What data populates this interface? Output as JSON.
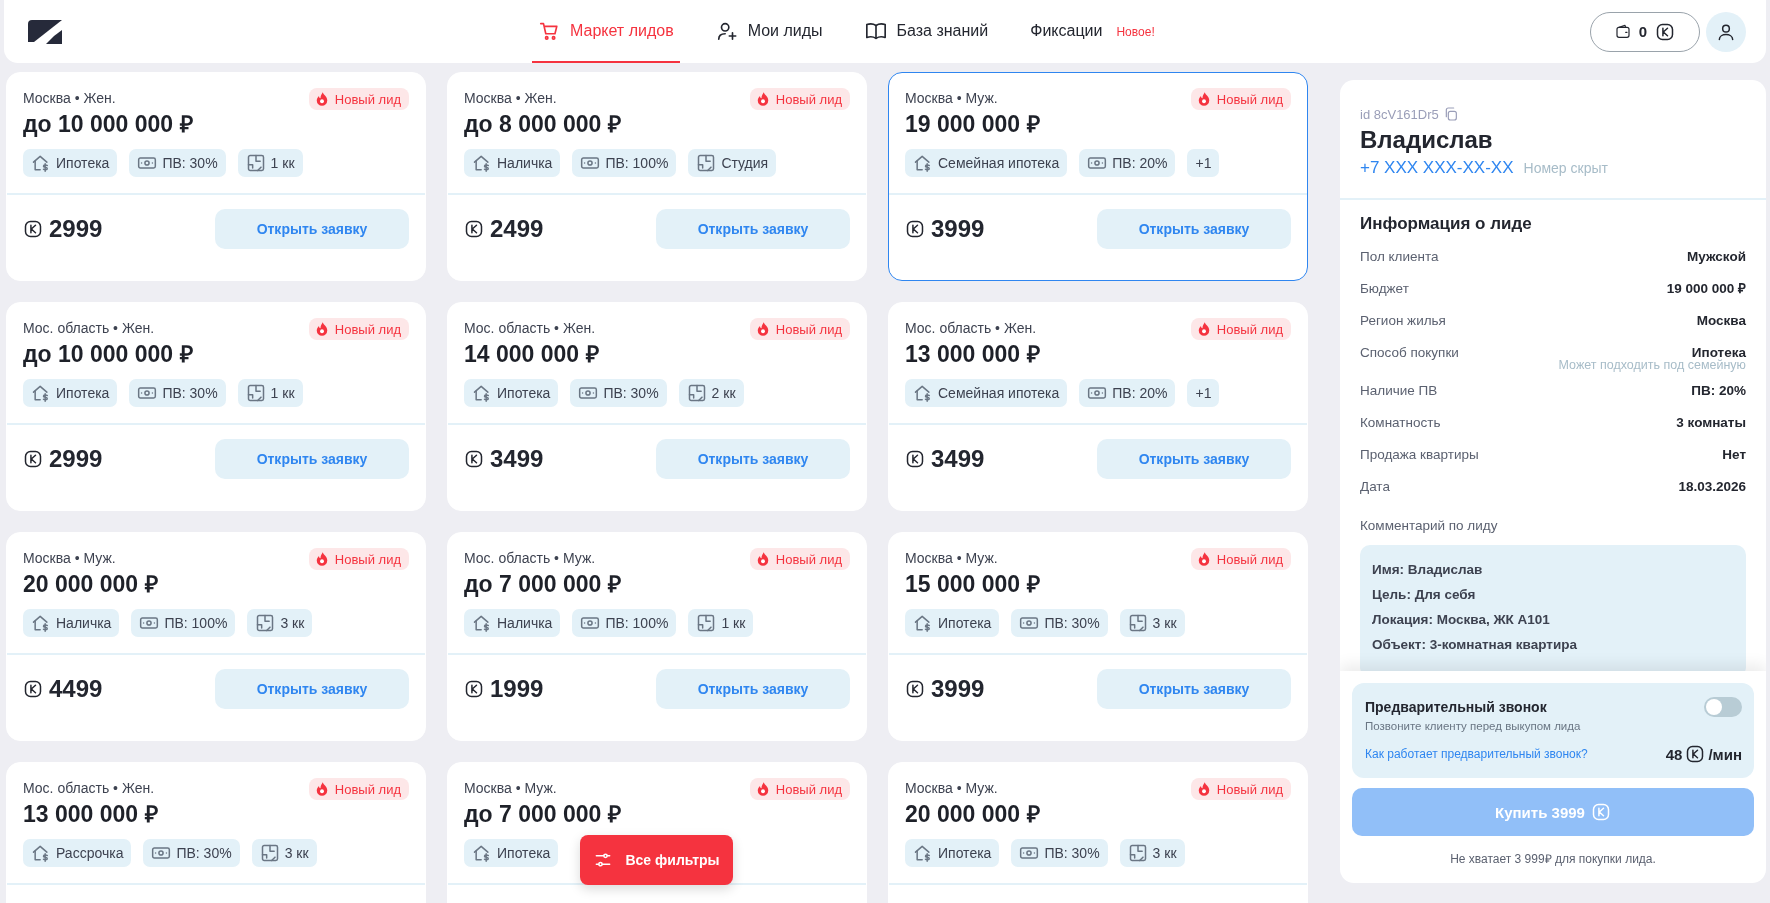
{
  "header": {
    "tabs": [
      {
        "kind": "cart",
        "label": "Маркет лидов",
        "selected": true
      },
      {
        "kind": "user-plus",
        "label": "Мои лиды",
        "selected": false
      },
      {
        "kind": "book",
        "label": "База знаний",
        "selected": false
      },
      {
        "kind": "none",
        "label": "Фиксации",
        "selected": false,
        "badge": "Новое!"
      }
    ],
    "balance": "0"
  },
  "cards": [
    {
      "location": "Москва • Жен.",
      "badge": "Новый лид",
      "budget": "до 10 000 000 ₽",
      "tags": [
        {
          "kind": "purchase",
          "label": "Ипотека"
        },
        {
          "kind": "pv",
          "label": "ПВ: 30%"
        },
        {
          "kind": "rooms",
          "label": "1 кк"
        }
      ],
      "price": "2999",
      "button": "Открыть заявку",
      "selected": false
    },
    {
      "location": "Москва • Жен.",
      "badge": "Новый лид",
      "budget": "до 8 000 000 ₽",
      "tags": [
        {
          "kind": "purchase",
          "label": "Наличка"
        },
        {
          "kind": "pv",
          "label": "ПВ: 100%"
        },
        {
          "kind": "rooms",
          "label": "Студия"
        }
      ],
      "price": "2499",
      "button": "Открыть заявку",
      "selected": false
    },
    {
      "location": "Москва • Муж.",
      "badge": "Новый лид",
      "budget": "19 000 000 ₽",
      "tags": [
        {
          "kind": "purchase",
          "label": "Семейная ипотека"
        },
        {
          "kind": "pv",
          "label": "ПВ: 20%"
        },
        {
          "kind": "more",
          "label": "+1"
        }
      ],
      "price": "3999",
      "button": "Открыть заявку",
      "selected": true
    },
    {
      "location": "Мос. область • Жен.",
      "badge": "Новый лид",
      "budget": "до 10 000 000 ₽",
      "tags": [
        {
          "kind": "purchase",
          "label": "Ипотека"
        },
        {
          "kind": "pv",
          "label": "ПВ: 30%"
        },
        {
          "kind": "rooms",
          "label": "1 кк"
        }
      ],
      "price": "2999",
      "button": "Открыть заявку",
      "selected": false
    },
    {
      "location": "Мос. область • Жен.",
      "badge": "Новый лид",
      "budget": "14 000 000 ₽",
      "tags": [
        {
          "kind": "purchase",
          "label": "Ипотека"
        },
        {
          "kind": "pv",
          "label": "ПВ: 30%"
        },
        {
          "kind": "rooms",
          "label": "2 кк"
        }
      ],
      "price": "3499",
      "button": "Открыть заявку",
      "selected": false
    },
    {
      "location": "Мос. область • Жен.",
      "badge": "Новый лид",
      "budget": "13 000 000 ₽",
      "tags": [
        {
          "kind": "purchase",
          "label": "Семейная ипотека"
        },
        {
          "kind": "pv",
          "label": "ПВ: 20%"
        },
        {
          "kind": "more",
          "label": "+1"
        }
      ],
      "price": "3499",
      "button": "Открыть заявку",
      "selected": false
    },
    {
      "location": "Москва • Муж.",
      "badge": "Новый лид",
      "budget": "20 000 000 ₽",
      "tags": [
        {
          "kind": "purchase",
          "label": "Наличка"
        },
        {
          "kind": "pv",
          "label": "ПВ: 100%"
        },
        {
          "kind": "rooms",
          "label": "3 кк"
        }
      ],
      "price": "4499",
      "button": "Открыть заявку",
      "selected": false
    },
    {
      "location": "Мос. область • Муж.",
      "badge": "Новый лид",
      "budget": "до 7 000 000 ₽",
      "tags": [
        {
          "kind": "purchase",
          "label": "Наличка"
        },
        {
          "kind": "pv",
          "label": "ПВ: 100%"
        },
        {
          "kind": "rooms",
          "label": "1 кк"
        }
      ],
      "price": "1999",
      "button": "Открыть заявку",
      "selected": false
    },
    {
      "location": "Москва • Муж.",
      "badge": "Новый лид",
      "budget": "15 000 000 ₽",
      "tags": [
        {
          "kind": "purchase",
          "label": "Ипотека"
        },
        {
          "kind": "pv",
          "label": "ПВ: 30%"
        },
        {
          "kind": "rooms",
          "label": "3 кк"
        }
      ],
      "price": "3999",
      "button": "Открыть заявку",
      "selected": false
    },
    {
      "location": "Мос. область • Жен.",
      "badge": "Новый лид",
      "budget": "13 000 000 ₽",
      "tags": [
        {
          "kind": "purchase",
          "label": "Рассрочка"
        },
        {
          "kind": "pv",
          "label": "ПВ: 30%"
        },
        {
          "kind": "rooms",
          "label": "3 кк"
        }
      ],
      "selected": false
    },
    {
      "location": "Москва • Муж.",
      "badge": "Новый лид",
      "budget": "до 7 000 000 ₽",
      "tags": [
        {
          "kind": "purchase",
          "label": "Ипотека"
        }
      ],
      "selected": false
    },
    {
      "location": "Москва • Муж.",
      "badge": "Новый лид",
      "budget": "20 000 000 ₽",
      "tags": [
        {
          "kind": "purchase",
          "label": "Ипотека"
        },
        {
          "kind": "pv",
          "label": "ПВ: 30%"
        },
        {
          "kind": "rooms",
          "label": "3 кк"
        }
      ],
      "selected": false
    }
  ],
  "filter_button": "Все фильтры",
  "lead": {
    "id": "id 8cV161Dr5",
    "name": "Владислав",
    "phone": "+7 XXX XXX-XX-XX",
    "phone_note": "Номер скрыт",
    "info_title": "Информация о лиде",
    "info": [
      {
        "label": "Пол клиента",
        "value": "Мужской"
      },
      {
        "label": "Бюджет",
        "value": "19 000 000 ₽"
      },
      {
        "label": "Регион жилья",
        "value": "Москва"
      },
      {
        "label": "Способ покупки",
        "value": "Ипотека",
        "note": "Может подходить под семейную"
      },
      {
        "label": "Наличие ПВ",
        "value": "ПВ: 20%"
      },
      {
        "label": "Комнатность",
        "value": "3 комнаты"
      },
      {
        "label": "Продажа квартиры",
        "value": "Нет"
      },
      {
        "label": "Дата",
        "value": "18.03.2026"
      }
    ],
    "comment_title": "Комментарий по лиду",
    "comment": [
      "Имя: Владислав",
      "Цель: Для себя",
      "Локация: Москва, ЖК А101",
      "Объект: 3-комнатная квартира"
    ],
    "precall": {
      "title": "Предварительный звонок",
      "subtitle": "Позвоните клиенту перед выкупом лида",
      "link": "Как работает предварительный звонок?",
      "rate": "48",
      "rate_unit": "/мин",
      "on": false
    },
    "buy": {
      "label": "Купить 3999",
      "disabled": true
    },
    "note": "Не хватает 3 999₽ для покупки лида."
  }
}
